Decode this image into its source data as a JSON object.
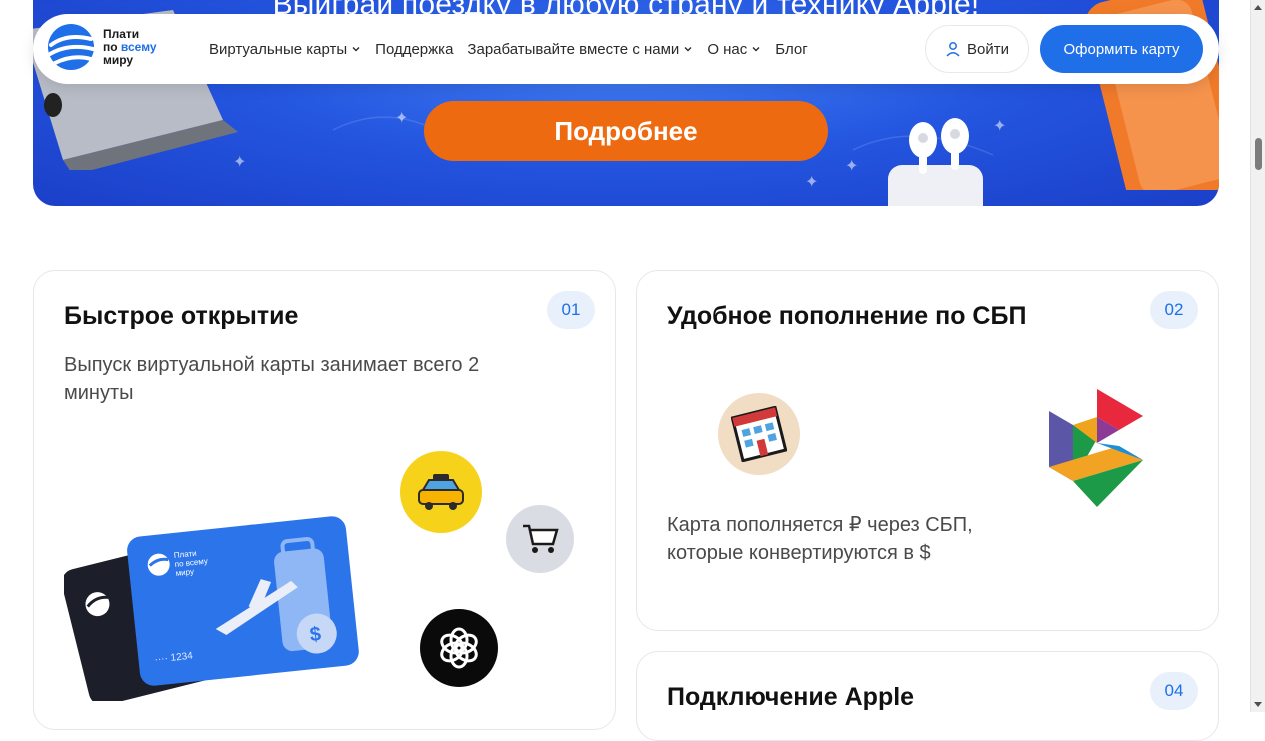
{
  "hero": {
    "title": "Выиграй поездку в любую страну и технику Apple!",
    "cta_label": "Подробнее"
  },
  "header": {
    "logo": {
      "line1": "Плати",
      "line2_a": "по",
      "line2_b": "всему",
      "line3": "миру"
    },
    "nav": [
      {
        "label": "Виртуальные карты",
        "has_dropdown": true
      },
      {
        "label": "Поддержка",
        "has_dropdown": false
      },
      {
        "label": "Зарабатывайте вместе с нами",
        "has_dropdown": true
      },
      {
        "label": "О нас",
        "has_dropdown": true
      },
      {
        "label": "Блог",
        "has_dropdown": false
      }
    ],
    "login_label": "Войти",
    "order_label": "Оформить карту"
  },
  "cards": [
    {
      "number": "01",
      "title": "Быстрое открытие",
      "description": "Выпуск виртуальной карты занимает всего 2 минуты",
      "card_brand_line1": "Плати",
      "card_brand_line2": "по всему",
      "card_brand_line3": "миру",
      "card_last_digits": "···· 1234"
    },
    {
      "number": "02",
      "title": "Удобное пополнение по СБП",
      "description": "Карта пополняется ₽ через СБП, которые конвертируются в $"
    },
    {
      "number": "04",
      "title": "Подключение Apple"
    }
  ],
  "colors": {
    "brand_blue": "#1e6fe8",
    "cta_orange": "#ee6a10",
    "hero_blue": "#2456e0"
  },
  "icons": [
    "user-icon",
    "chevron-down-icon",
    "taxi-icon",
    "cart-icon",
    "openai-icon",
    "hotel-icon",
    "sbp-logo-icon",
    "plane-icon",
    "dollar-coin-icon"
  ]
}
